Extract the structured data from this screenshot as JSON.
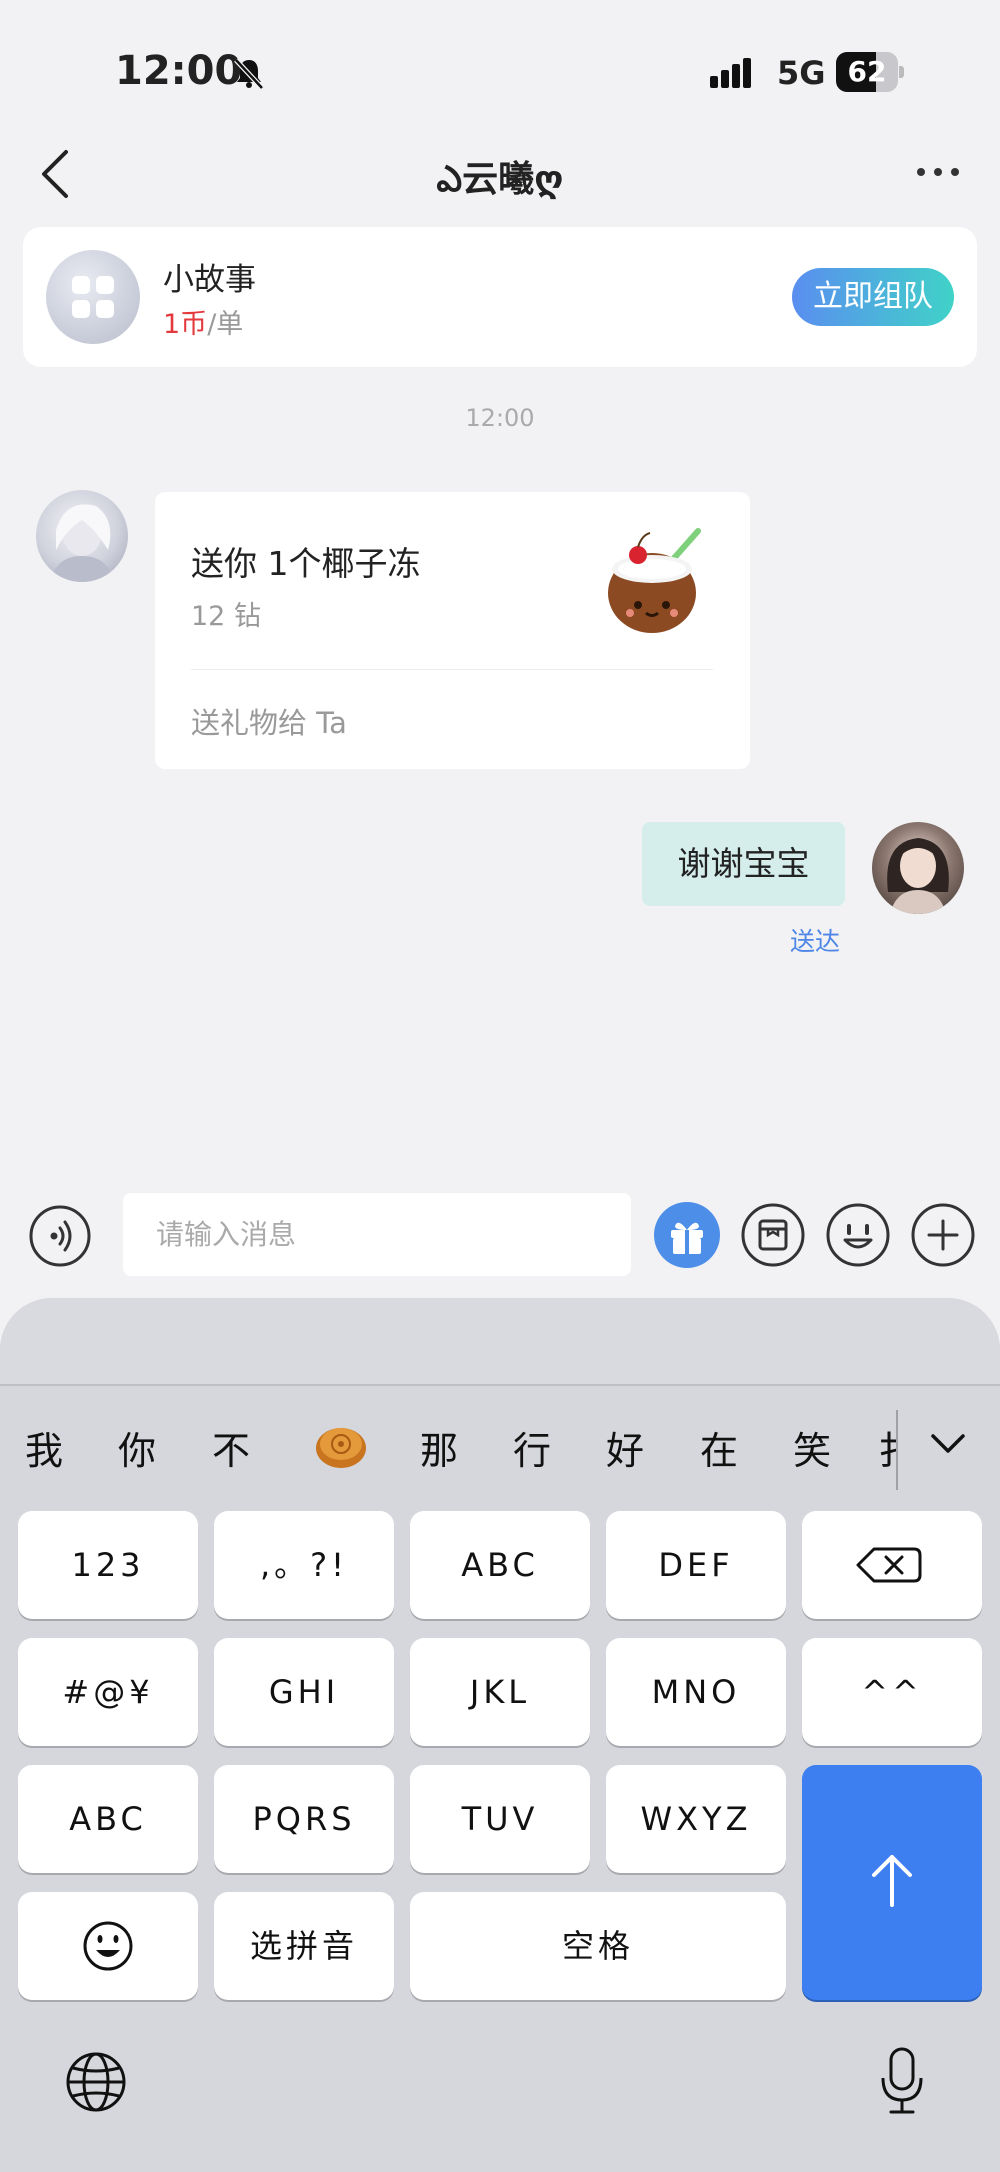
{
  "status_bar": {
    "time": "12:00",
    "network": "5G",
    "battery": "62"
  },
  "header": {
    "title": "ఎ云曦ღ"
  },
  "team_card": {
    "name": "小故事",
    "price_amount": "1币",
    "price_unit": "/单",
    "button_label": "立即组队"
  },
  "chat": {
    "time_divider": "12:00",
    "gift_message": {
      "title": "送你 1个椰子冻",
      "price": "12 钻",
      "action": "送礼物给 Ta"
    },
    "my_message": {
      "text": "谢谢宝宝",
      "status": "送达"
    }
  },
  "input": {
    "placeholder": "请输入消息"
  },
  "keyboard": {
    "candidates": [
      "我",
      "你",
      "不",
      "那",
      "行",
      "好",
      "在",
      "笑",
      "扌"
    ],
    "candidate_emoji": "mooncake-emoji",
    "rows": [
      [
        "123",
        ",。?!",
        "ABC",
        "DEF"
      ],
      [
        "#@¥",
        "GHI",
        "JKL",
        "MNO",
        "^^"
      ],
      [
        "ABC",
        "PQRS",
        "TUV",
        "WXYZ"
      ],
      [
        "选拼音",
        "空格"
      ]
    ],
    "icons": [
      "delete-icon",
      "emoji-face-icon",
      "send-arrow-icon",
      "globe-icon",
      "microphone-icon",
      "chevron-down-icon"
    ]
  },
  "colors": {
    "accent": "#3d7ef0",
    "price_red": "#e4393c",
    "bubble": "#d5eeec",
    "delivered": "#4d86e6"
  }
}
